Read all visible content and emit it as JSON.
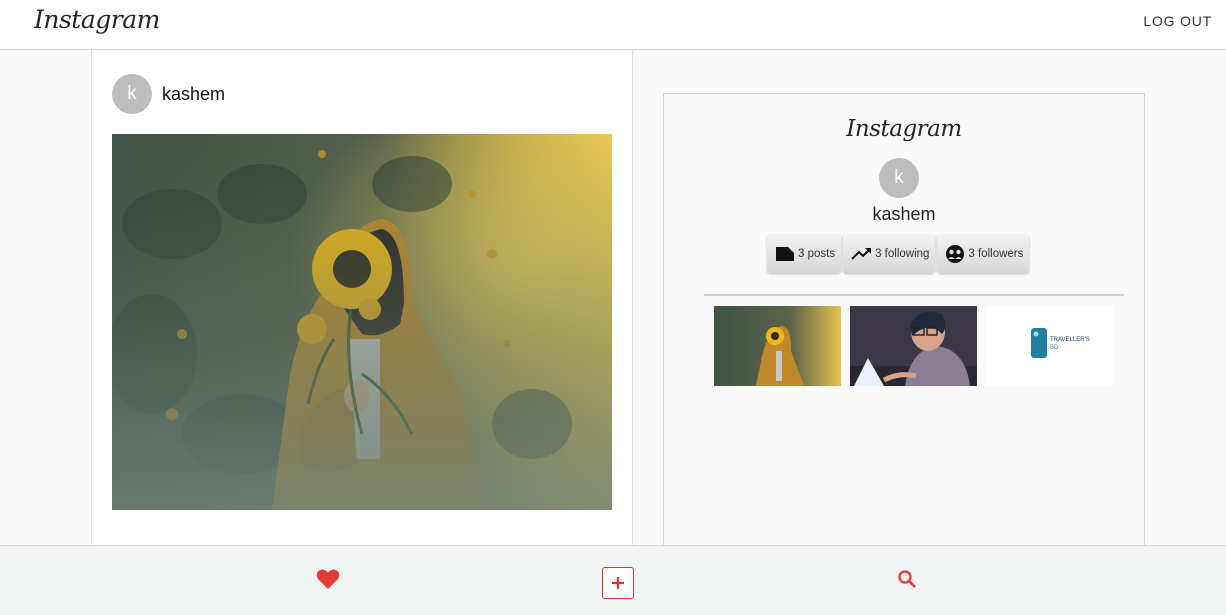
{
  "header": {
    "logo": "Instagram",
    "logout_label": "LOG OUT"
  },
  "post": {
    "avatar_letter": "k",
    "username": "kashem"
  },
  "profile": {
    "logo": "Instagram",
    "avatar_letter": "k",
    "username": "kashem",
    "stats": {
      "posts": "3 posts",
      "following": "3 following",
      "followers": "3 followers"
    },
    "thumbnail_texts": {
      "third_logo_line1": "TRAVELLER'S",
      "third_logo_line2": "BD"
    }
  },
  "bottom_nav": {
    "icons": [
      "heart-icon",
      "add-icon",
      "search-icon"
    ],
    "accent_color": "#e53935"
  }
}
